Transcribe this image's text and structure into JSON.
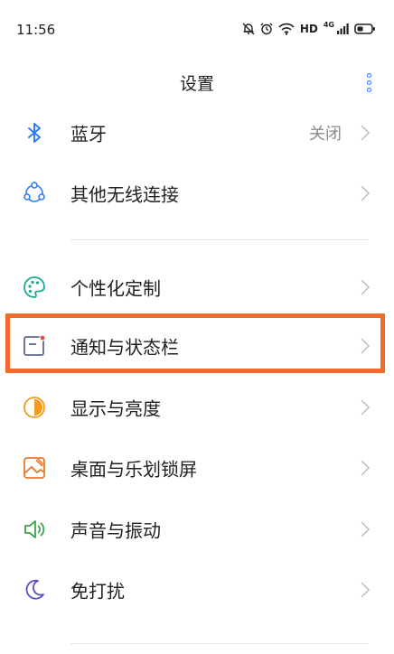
{
  "status_bar": {
    "time": "11:56",
    "hd_label": "HD",
    "network_label": "4G"
  },
  "header": {
    "title": "设置"
  },
  "items": [
    {
      "label": "蓝牙",
      "value": "关闭",
      "icon": "bluetooth-icon"
    },
    {
      "label": "其他无线连接",
      "icon": "wireless-connection-icon"
    },
    {
      "label": "个性化定制",
      "icon": "palette-icon"
    },
    {
      "label": "通知与状态栏",
      "icon": "notification-icon"
    },
    {
      "label": "显示与亮度",
      "icon": "brightness-icon"
    },
    {
      "label": "桌面与乐划锁屏",
      "icon": "wallpaper-icon"
    },
    {
      "label": "声音与振动",
      "icon": "speaker-icon"
    },
    {
      "label": "免打扰",
      "icon": "moon-icon"
    }
  ],
  "colors": {
    "accent": "#2f7cf6",
    "highlight": "#f26a2e"
  }
}
